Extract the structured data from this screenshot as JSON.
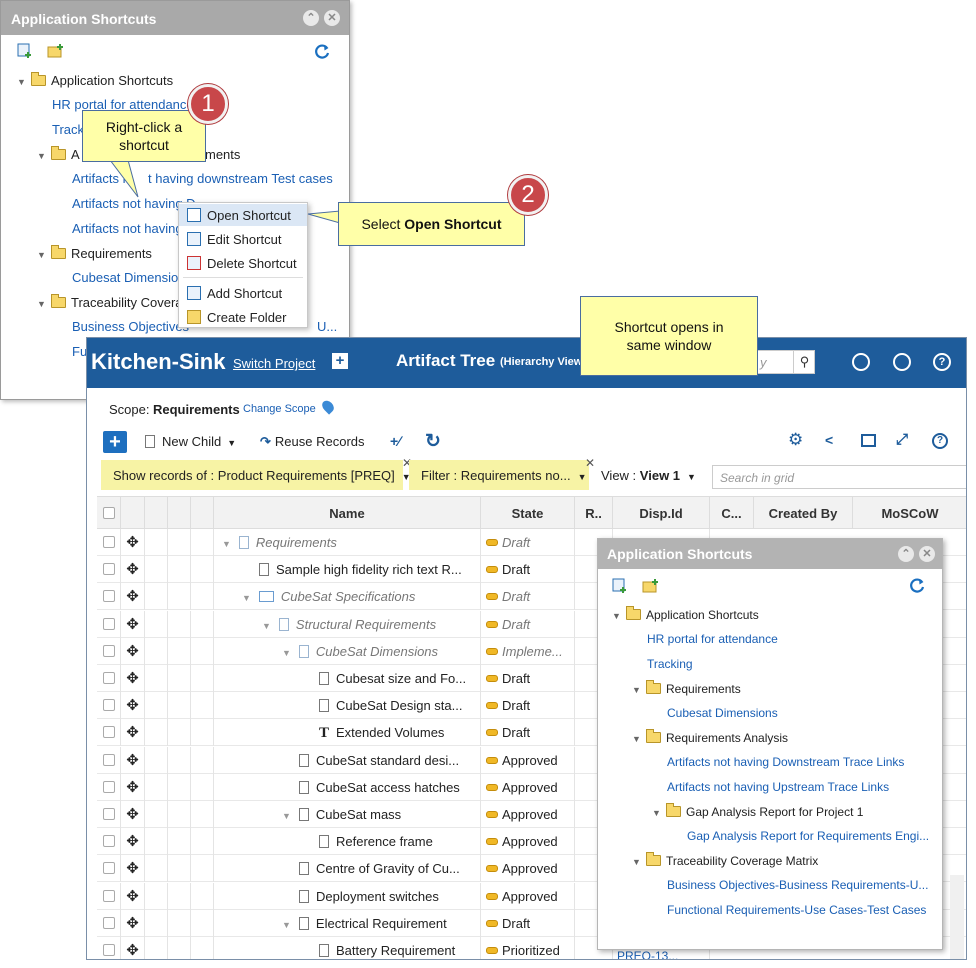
{
  "panel1": {
    "title": "Application Shortcuts",
    "tree": {
      "root": "Application Shortcuts",
      "links_top": [
        "HR portal for attendance",
        "Track"
      ],
      "folder_req_analysis_partial": "A",
      "folder_req_analysis_tail": "ments",
      "analysis_links": [
        "Artifacts n",
        "t having downstream Test cases",
        "Artifacts not having D",
        "Artifacts not having U"
      ],
      "folder_requirements": "Requirements",
      "req_link": "Cubesat Dimensions",
      "folder_trace": "Traceability Coverag",
      "trace_link": "Business Objectives-",
      "trace_link_tail": "U...",
      "last_link_partial": "Fu"
    }
  },
  "context_menu": {
    "items": [
      "Open Shortcut",
      "Edit Shortcut",
      "Delete Shortcut",
      "Add Shortcut",
      "Create Folder"
    ]
  },
  "callouts": {
    "step1_number": "1",
    "step1_text": "Right-click a shortcut",
    "step2_number": "2",
    "step2_prefix": "Select ",
    "step2_bold": "Open Shortcut",
    "step3_text": "Shortcut opens in same window"
  },
  "app": {
    "brand": "Kitchen-Sink",
    "switch_project": "Switch Project",
    "view_title": "Artifact Tree",
    "view_subtitle": "(Hierarchy View)",
    "search_placeholder": "y",
    "scope_label": "Scope:",
    "scope_value": "Requirements",
    "change_scope": "Change Scope",
    "toolbar": {
      "new_child": "New Child",
      "reuse_records": "Reuse Records"
    },
    "filters": {
      "show_records": "Show records of : Product Requirements [PREQ]",
      "filter": "Filter : Requirements no...",
      "view_label": "View :",
      "view_value": "View 1",
      "grid_search_placeholder": "Search in grid"
    },
    "grid": {
      "columns": [
        "Name",
        "State",
        "R..",
        "Disp.Id",
        "C...",
        "Created By",
        "MoSCoW"
      ],
      "rows": [
        {
          "name": "Requirements",
          "state": "Draft",
          "italic": true
        },
        {
          "name": "Sample high fidelity rich text R...",
          "state": "Draft",
          "italic": false
        },
        {
          "name": "CubeSat Specifications",
          "state": "Draft",
          "italic": true
        },
        {
          "name": "Structural Requirements",
          "state": "Draft",
          "italic": true
        },
        {
          "name": "CubeSat Dimensions",
          "state": "Impleme...",
          "italic": true
        },
        {
          "name": "Cubesat size and Fo...",
          "state": "Draft",
          "italic": false
        },
        {
          "name": "CubeSat Design sta...",
          "state": "Draft",
          "italic": false
        },
        {
          "name": "Extended Volumes",
          "state": "Draft",
          "italic": false
        },
        {
          "name": "CubeSat standard desi...",
          "state": "Approved",
          "italic": false
        },
        {
          "name": "CubeSat access hatches",
          "state": "Approved",
          "italic": false
        },
        {
          "name": "CubeSat mass",
          "state": "Approved",
          "italic": false
        },
        {
          "name": "Reference frame",
          "state": "Approved",
          "italic": false
        },
        {
          "name": "Centre of Gravity of Cu...",
          "state": "Approved",
          "italic": false
        },
        {
          "name": "Deployment switches",
          "state": "Approved",
          "italic": false
        },
        {
          "name": "Electrical Requirement",
          "state": "Draft",
          "italic": false
        },
        {
          "name": "Battery Requirement",
          "state": "Prioritized",
          "italic": false
        }
      ],
      "last_disp_partial": "PREQ-13..."
    }
  },
  "panel2": {
    "title": "Application Shortcuts",
    "tree": {
      "root": "Application Shortcuts",
      "hr": "HR portal for attendance",
      "tracking": "Tracking",
      "folder_requirements": "Requirements",
      "cubesat": "Cubesat Dimensions",
      "folder_analysis": "Requirements Analysis",
      "downstream": "Artifacts not having Downstream Trace Links",
      "upstream": "Artifacts not having Upstream Trace Links",
      "folder_gap": "Gap Analysis Report for Project 1",
      "gap_link": "Gap Analysis Report for Requirements Engi...",
      "folder_trace": "Traceability Coverage Matrix",
      "bo_link": "Business Objectives-Business Requirements-U...",
      "fr_link": "Functional Requirements-Use Cases-Test Cases"
    }
  },
  "colors": {
    "app_bar": "#1e5c9b",
    "callout_fill": "#ffffa8",
    "badge": "#c8474a",
    "filter_chip": "#f7f3a5",
    "link": "#1a5fb4"
  }
}
